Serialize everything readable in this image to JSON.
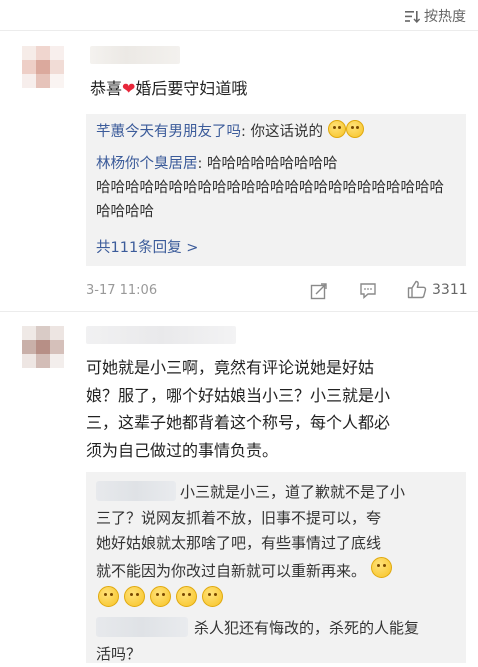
{
  "sort": {
    "label": "按热度",
    "icon": "sort-icon"
  },
  "comments": [
    {
      "content_prefix": "恭喜",
      "content_suffix": "婚后要守妇道哦",
      "content_emoji": "heart-emoji",
      "replies": [
        {
          "user": "芊蕙今天有男朋友了吗",
          "text": ": 你这话说的"
        },
        {
          "user": "林杨你个臭居居",
          "text": ": 哈哈哈哈哈哈哈哈哈哈哈哈哈哈哈哈哈哈哈哈哈哈哈哈哈哈哈哈哈哈哈哈哈"
        }
      ],
      "more_replies": "共111条回复 >",
      "timestamp": "3-17 11:06",
      "like_count": "3311",
      "reply_text_line2": "哈哈哈哈哈哈哈哈哈哈哈哈哈哈哈哈哈哈哈哈哈哈哈哈",
      "reply_text_line3": "哈哈哈哈"
    },
    {
      "content_lines": [
        "可她就是小三啊，竟然有评论说她是好姑",
        "娘？服了，哪个好姑娘当小三？小三就是小",
        "三，这辈子她都背着这个称号，每个人都必",
        "须为自己做过的事情负责。"
      ],
      "reply1_lines": [
        "小三就是小三，道了歉就不是了小",
        "三了？说网友抓着不放，旧事不提可以，夸",
        "她好姑娘就太那啥了吧，有些事情过了底线",
        "就不能因为你改过自新就可以重新再来。"
      ],
      "reply2_lines": [
        "杀人犯还有悔改的，杀死的人能复",
        "活吗？"
      ]
    }
  ]
}
